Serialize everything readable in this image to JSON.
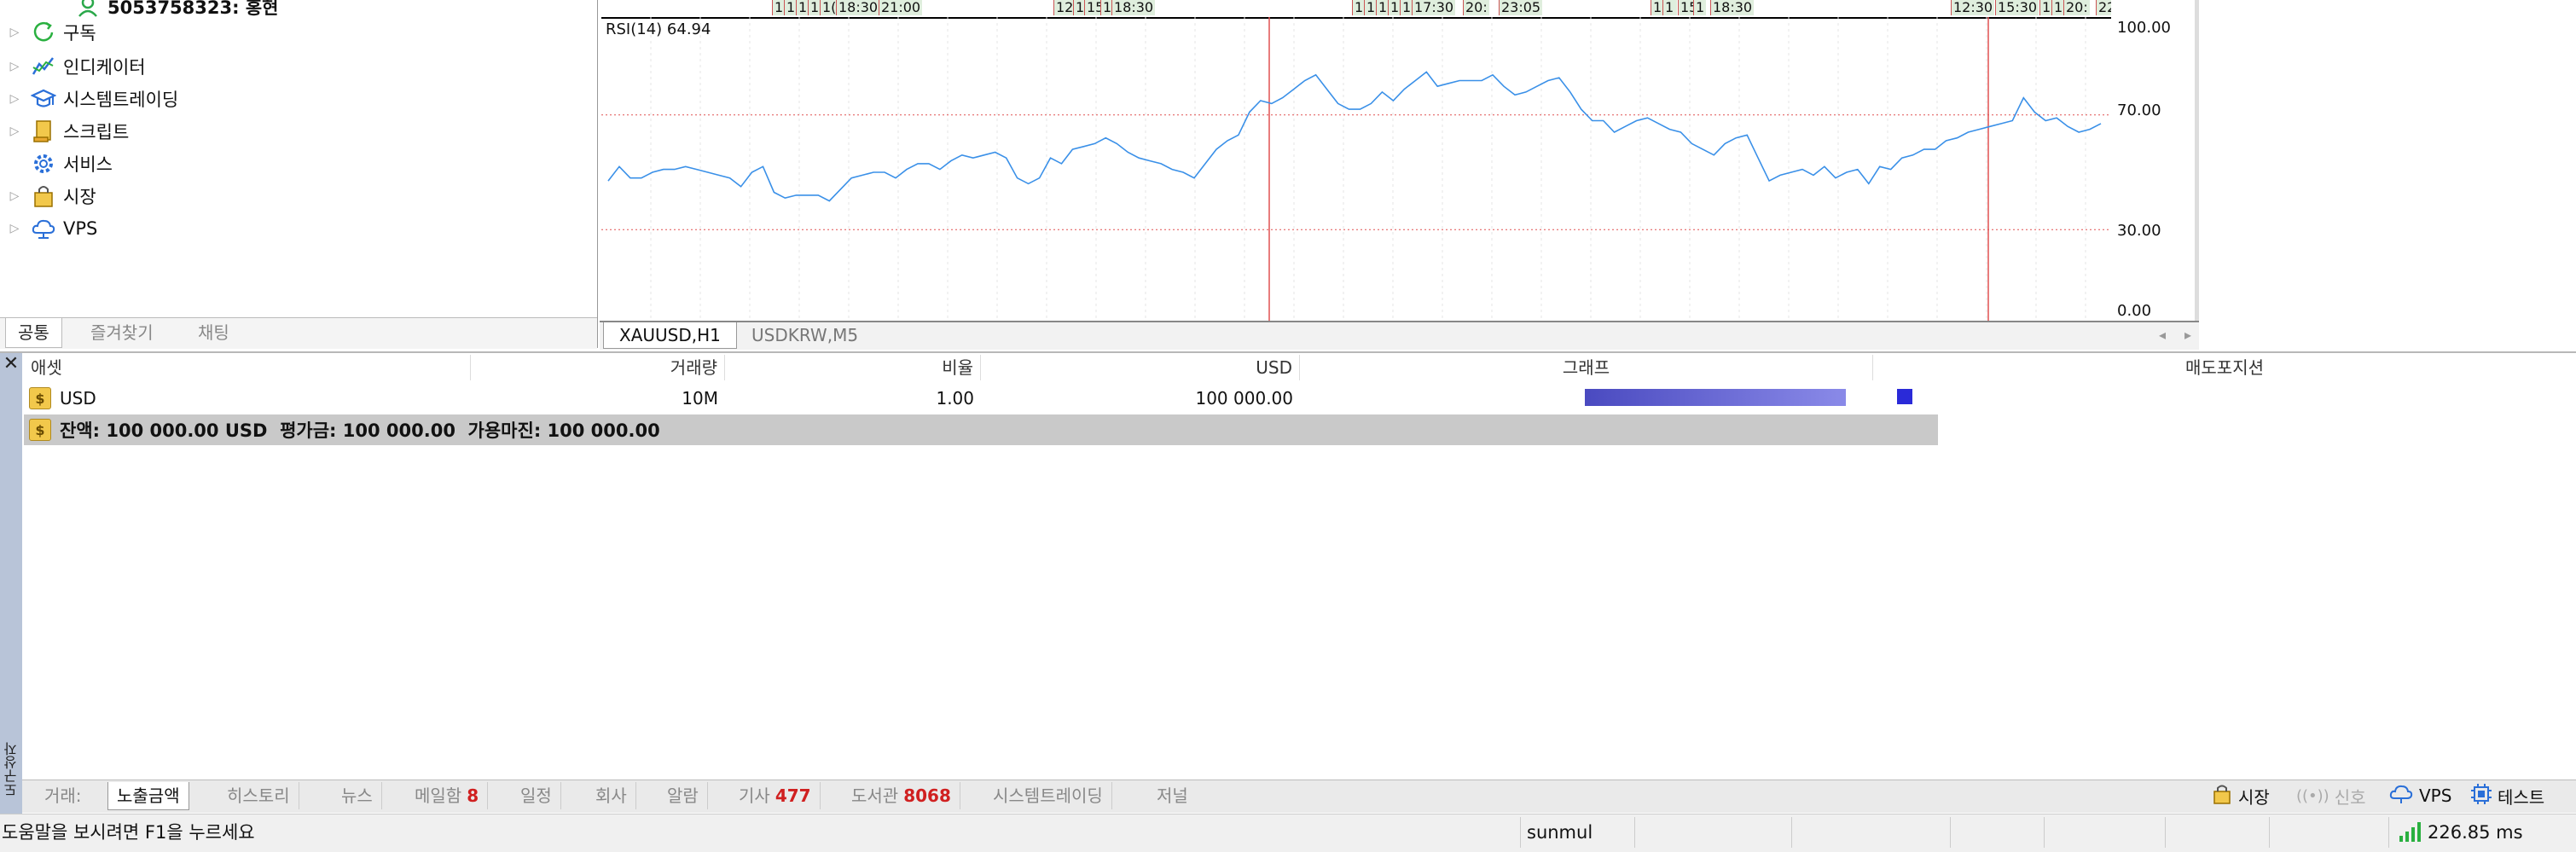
{
  "navigator": {
    "account_label": "5053758323: 홍현",
    "items": [
      {
        "label": "구독",
        "icon": "subscription-icon"
      },
      {
        "label": "인디케이터",
        "icon": "indicator-icon"
      },
      {
        "label": "시스템트레이딩",
        "icon": "expert-advisor-icon"
      },
      {
        "label": "스크립트",
        "icon": "script-icon"
      },
      {
        "label": "서비스",
        "icon": "service-gear-icon"
      },
      {
        "label": "시장",
        "icon": "market-bag-icon"
      },
      {
        "label": "VPS",
        "icon": "vps-cloud-icon"
      }
    ],
    "tabs": [
      "공통",
      "즐겨찾기",
      "채팅"
    ]
  },
  "chart": {
    "indicator_title": "RSI(14) 64.94",
    "time_labels": [
      "1",
      "1",
      "1",
      "1",
      "1(",
      "18:30",
      "21:00",
      "12:",
      "1",
      "15:",
      "1",
      "18:30",
      "1",
      "1",
      "1",
      "1",
      "1(",
      "17:30",
      "20:",
      "23:05",
      "12:",
      "1",
      "15:",
      "1",
      "18:30",
      "12:30",
      "15:30",
      "1",
      "1",
      "20:",
      "22:"
    ],
    "tabs": [
      "XAUUSD,H1",
      "USDKRW,M5"
    ],
    "active_tab": 0
  },
  "chart_data": {
    "type": "line",
    "title": "RSI(14) 64.94",
    "ylim": [
      0,
      100
    ],
    "yticks": [
      "100.00",
      "70.00",
      "30.00",
      "0.00"
    ],
    "levels": [
      70,
      30
    ],
    "series": [
      {
        "name": "RSI(14)",
        "values": [
          47,
          52,
          48,
          48,
          50,
          51,
          51,
          52,
          51,
          50,
          49,
          48,
          45,
          50,
          52,
          43,
          41,
          42,
          42,
          42,
          40,
          44,
          48,
          49,
          50,
          50,
          48,
          51,
          53,
          53,
          51,
          54,
          56,
          55,
          56,
          57,
          55,
          48,
          46,
          48,
          55,
          53,
          58,
          59,
          60,
          62,
          60,
          57,
          55,
          54,
          53,
          51,
          50,
          48,
          53,
          58,
          61,
          63,
          71,
          75,
          74,
          76,
          79,
          82,
          84,
          79,
          74,
          72,
          72,
          74,
          78,
          75,
          79,
          82,
          85,
          80,
          81,
          82,
          82,
          82,
          84,
          80,
          77,
          78,
          80,
          82,
          83,
          78,
          72,
          68,
          68,
          64,
          66,
          68,
          69,
          67,
          65,
          64,
          60,
          58,
          56,
          60,
          62,
          63,
          55,
          47,
          49,
          50,
          51,
          49,
          52,
          48,
          50,
          51,
          46,
          52,
          51,
          55,
          56,
          58,
          58,
          61,
          62,
          64,
          65,
          66,
          67,
          68,
          76,
          71,
          68,
          69,
          66,
          64,
          65,
          67
        ],
        "color": "#3a90e8"
      }
    ],
    "marker_lines_color": "#e05050"
  },
  "toolbox": {
    "columns": [
      "애셋",
      "거래량",
      "비율",
      "USD",
      "그래프",
      "매도포지션"
    ],
    "rows": [
      {
        "asset": "USD",
        "volume": "10M",
        "rate": "1.00",
        "usd": "100 000.00",
        "graph_fill": 1.0
      }
    ],
    "summary": "잔액: 100 000.00 USD  평가금: 100 000.00  가용마진: 100 000.00",
    "side_label": "도구상자",
    "tabs": [
      {
        "label": "거래:"
      },
      {
        "label": "노출금액"
      },
      {
        "label": "히스토리"
      },
      {
        "label": "뉴스"
      },
      {
        "label": "메일함",
        "count": "8"
      },
      {
        "label": "일정"
      },
      {
        "label": "회사"
      },
      {
        "label": "알람"
      },
      {
        "label": "기사",
        "count": "477"
      },
      {
        "label": "도서관",
        "count": "8068"
      },
      {
        "label": "시스템트레이딩"
      },
      {
        "label": "저널"
      }
    ],
    "active_tab": 1,
    "right_tools": [
      {
        "label": "시장",
        "icon": "market-bag-icon"
      },
      {
        "label": "신호",
        "icon": "signal-icon"
      },
      {
        "label": "VPS",
        "icon": "vps-cloud-icon"
      },
      {
        "label": "테스트",
        "icon": "tester-chip-icon"
      }
    ]
  },
  "statusbar": {
    "help": "도움말을 보시려면 F1을 누르세요",
    "profile": "sunmul",
    "ping": "226.85 ms"
  },
  "colors": {
    "graph_bar": "#5a5ad0",
    "accent_blue": "#2a2ad8",
    "count_red": "#d02020",
    "rsi_line": "#3a90e8",
    "level_line": "#e05050"
  }
}
